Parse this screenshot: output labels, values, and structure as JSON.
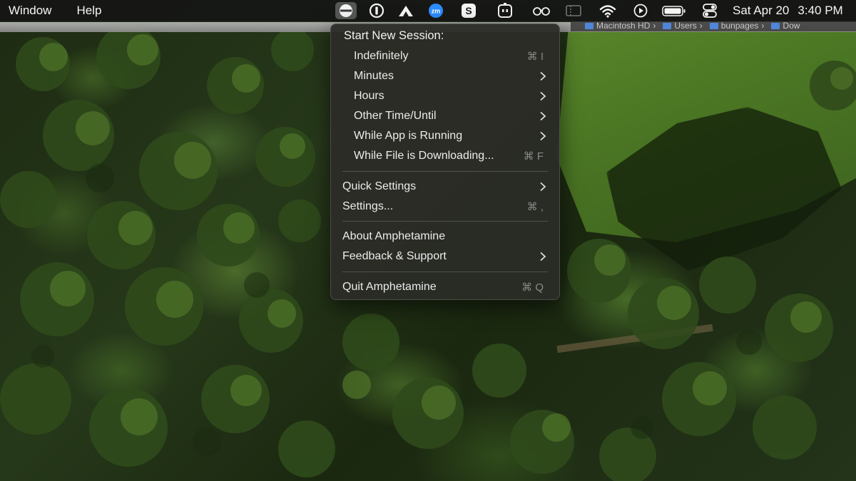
{
  "menubar": {
    "app_menus": [
      "Window",
      "Help"
    ],
    "status_icons": [
      "amphetamine-pill-icon",
      "1password-icon",
      "mountain-icon",
      "zoom-icon",
      "skype-icon",
      "robot-icon",
      "glasses-icon",
      "sidebar-toggle-icon",
      "wifi-icon",
      "play-circle-icon",
      "battery-icon",
      "control-center-icon"
    ],
    "zoom_badge": "zm",
    "skype_badge": "S",
    "date": "Sat Apr 20",
    "time": "3:40 PM"
  },
  "pathbar": {
    "crumbs": [
      "Macintosh HD",
      "Users",
      "bunpages",
      "Dow"
    ]
  },
  "menu": {
    "header": "Start New Session:",
    "session_items": [
      {
        "label": "Indefinitely",
        "shortcut": "⌘ I",
        "submenu": false
      },
      {
        "label": "Minutes",
        "shortcut": "",
        "submenu": true
      },
      {
        "label": "Hours",
        "shortcut": "",
        "submenu": true
      },
      {
        "label": "Other Time/Until",
        "shortcut": "",
        "submenu": true
      },
      {
        "label": "While App is Running",
        "shortcut": "",
        "submenu": true
      },
      {
        "label": "While File is Downloading...",
        "shortcut": "⌘ F",
        "submenu": false
      }
    ],
    "settings_items": [
      {
        "label": "Quick Settings",
        "shortcut": "",
        "submenu": true
      },
      {
        "label": "Settings...",
        "shortcut": "⌘ ,",
        "submenu": false
      }
    ],
    "about_items": [
      {
        "label": "About Amphetamine",
        "shortcut": "",
        "submenu": false
      },
      {
        "label": "Feedback & Support",
        "shortcut": "",
        "submenu": true
      }
    ],
    "quit_item": {
      "label": "Quit Amphetamine",
      "shortcut": "⌘ Q",
      "submenu": false
    }
  },
  "colors": {
    "menubar_bg": "#161616",
    "menu_bg": "#2a2c26",
    "shortcut_text": "#8a8a8a",
    "zoom_blue": "#2d8cff"
  }
}
